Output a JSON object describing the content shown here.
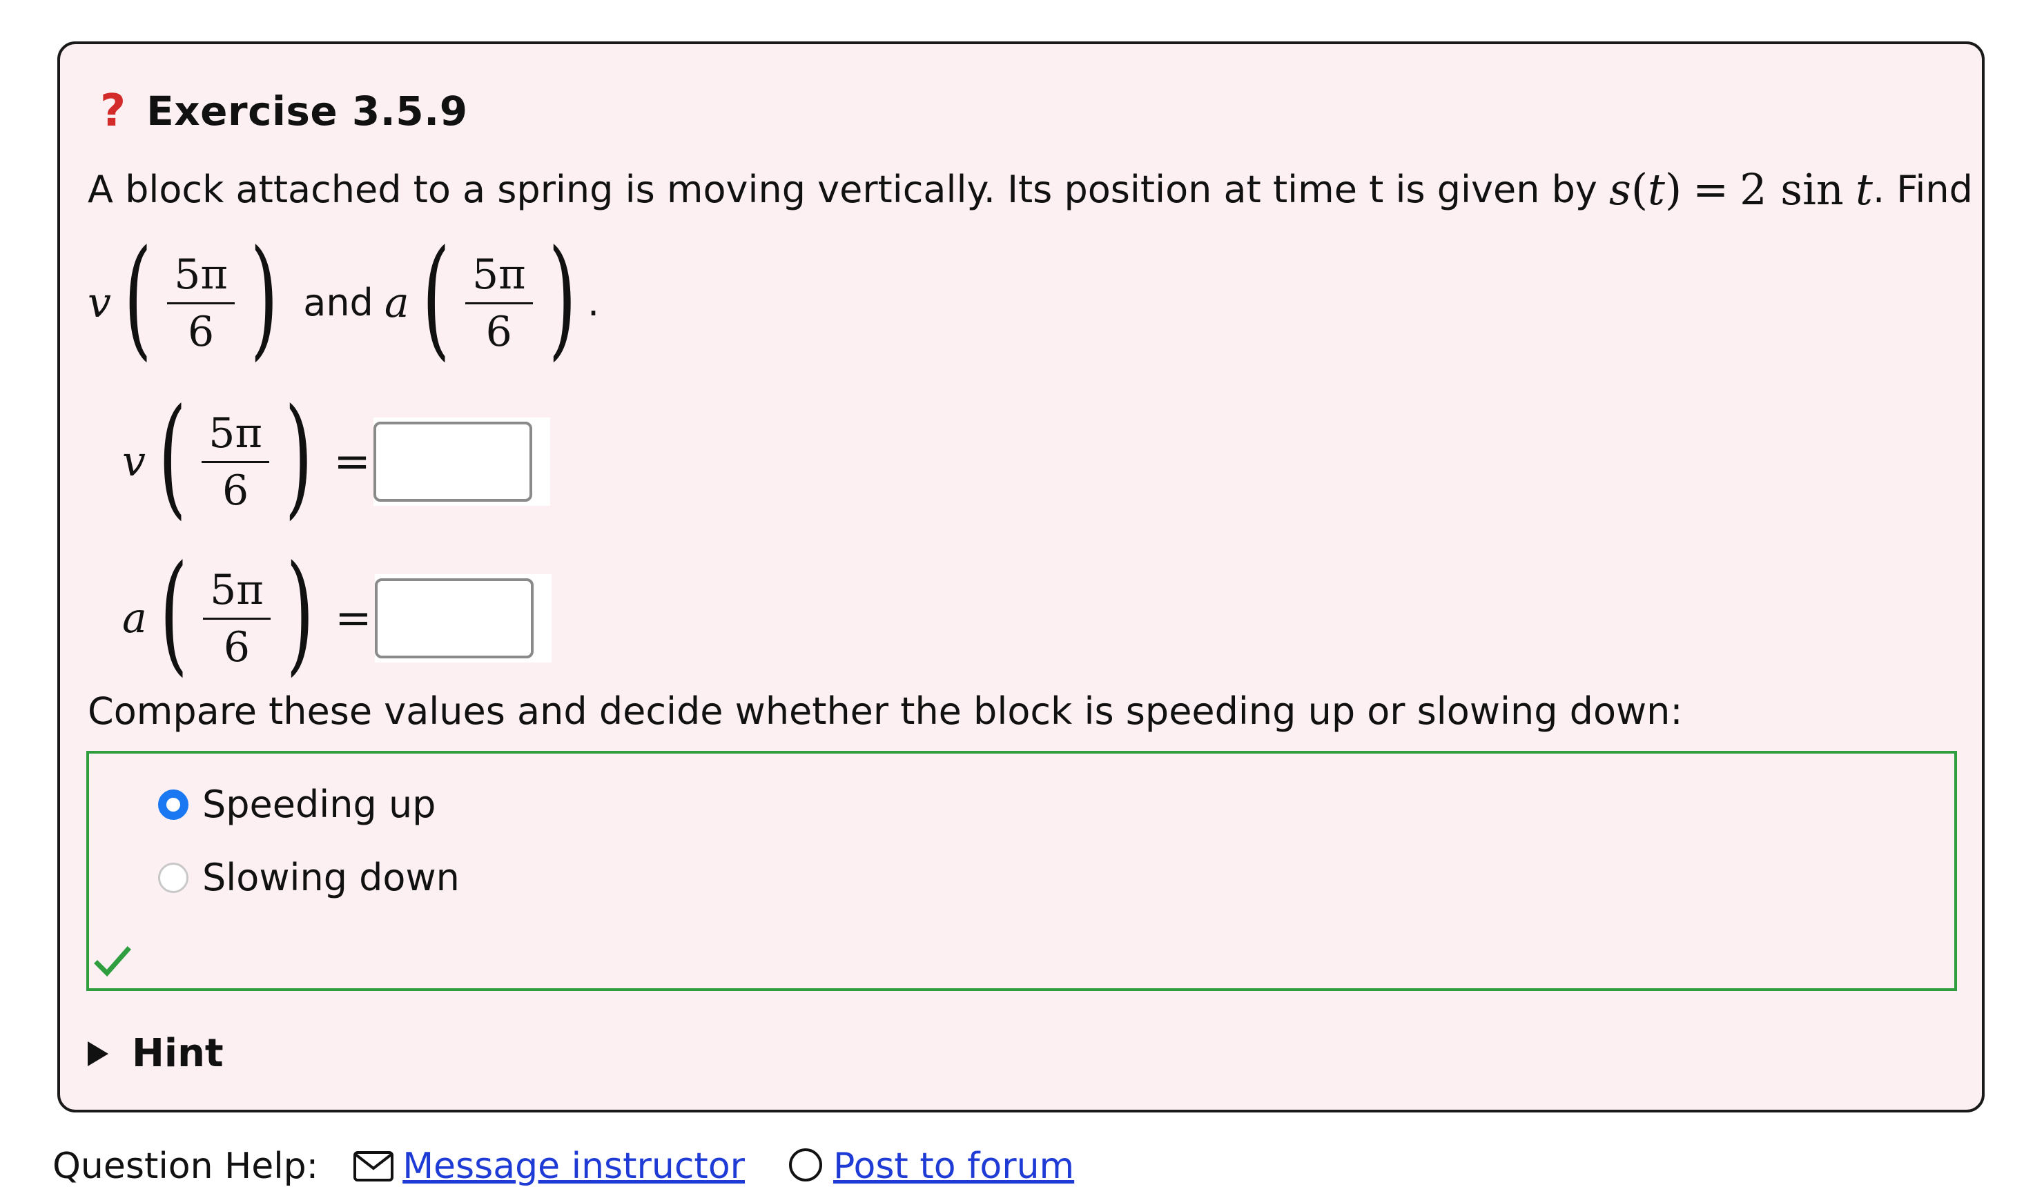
{
  "exercise": {
    "title": "Exercise 3.5.9",
    "intro_text": "A block attached to a spring is moving vertically. Its position at time t is given by",
    "formula_s": "s",
    "formula_t": "t",
    "formula_rhs_coef": "2 sin",
    "formula_rhs_var": "t",
    "find_label": ". Find",
    "and_label": "and",
    "period": ".",
    "fn_v": "v",
    "fn_a": "a",
    "frac_num": "5π",
    "frac_den": "6",
    "equals": "="
  },
  "answers": {
    "v_value": "",
    "a_value": ""
  },
  "compare_prompt": "Compare these values and decide whether the block is speeding up or slowing down:",
  "choices": [
    {
      "label": "Speeding up",
      "selected": true
    },
    {
      "label": "Slowing down",
      "selected": false
    }
  ],
  "hint_label": "Hint",
  "help": {
    "label": "Question Help:",
    "message_link": "Message instructor",
    "forum_link": "Post to forum"
  },
  "colors": {
    "card_bg": "#fdf0f2",
    "question_icon": "#d32a2a",
    "correct_border": "#2e9e3e",
    "radio_selected": "#1a79f2",
    "link": "#1f3bd6"
  }
}
